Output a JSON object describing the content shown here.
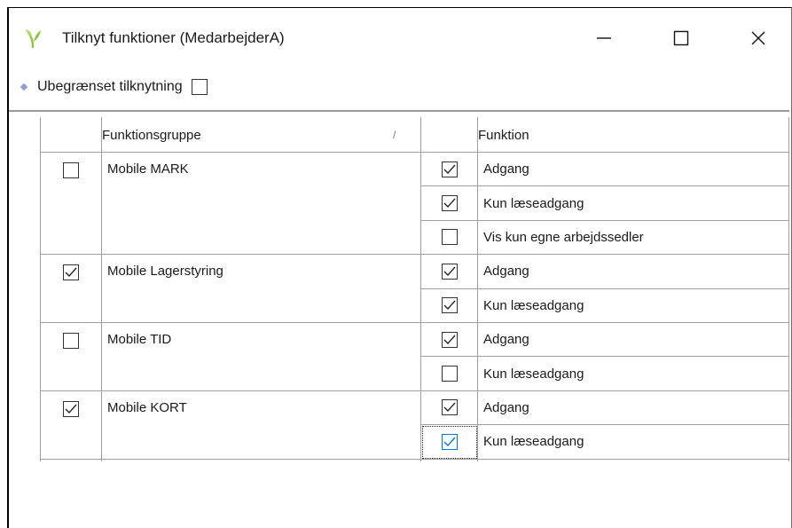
{
  "window": {
    "title": "Tilknyt funktioner (MedarbejderA)",
    "accent": "#8cc63f"
  },
  "unlimited": {
    "label": "Ubegrænset tilknytning",
    "checked": false
  },
  "table": {
    "headers": {
      "group": "Funktionsgruppe",
      "sort_indicator": "/",
      "function": "Funktion"
    },
    "groups": [
      {
        "name": "Mobile MARK",
        "checked": false,
        "functions": [
          {
            "label": "Adgang",
            "checked": true
          },
          {
            "label": "Kun læseadgang",
            "checked": true
          },
          {
            "label": "Vis kun egne arbejdssedler",
            "checked": false
          }
        ]
      },
      {
        "name": "Mobile Lagerstyring",
        "checked": true,
        "functions": [
          {
            "label": "Adgang",
            "checked": true
          },
          {
            "label": "Kun læseadgang",
            "checked": true
          }
        ]
      },
      {
        "name": "Mobile TID",
        "checked": false,
        "functions": [
          {
            "label": "Adgang",
            "checked": true
          },
          {
            "label": "Kun læseadgang",
            "checked": false
          }
        ]
      },
      {
        "name": "Mobile KORT",
        "checked": true,
        "functions": [
          {
            "label": "Adgang",
            "checked": true
          },
          {
            "label": "Kun læseadgang",
            "checked": true,
            "focused": true
          }
        ]
      }
    ]
  }
}
